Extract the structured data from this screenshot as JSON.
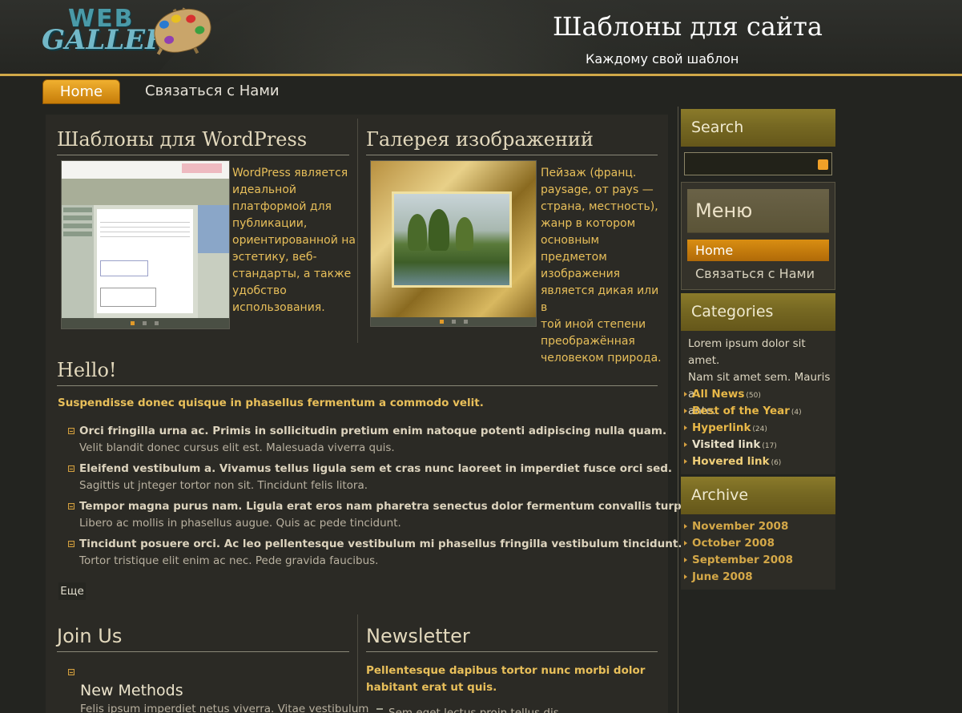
{
  "header": {
    "logo_line1": "WEB",
    "logo_line2": "GALLERY",
    "title": "Шаблоны для сайта",
    "slogan": "Каждому свой шаблон"
  },
  "nav": {
    "home": "Home",
    "contact": "Связаться с Нами"
  },
  "articles": {
    "wordpress": {
      "title": "Шаблоны для WordPress",
      "text_lines": [
        "WordPress является",
        "идеальной",
        "платформой для",
        "публикации,",
        "ориентированной на",
        "эстетику, веб-",
        "стандарты, а также",
        "удобство",
        "использования."
      ]
    },
    "gallery": {
      "title": "Галерея изображений",
      "text_lines": [
        "Пейзаж  (франц.",
        "paysage, от pays —",
        "страна, местность),",
        "жанр  в котором",
        "основным предметом",
        "изображения",
        "является дикая или в",
        "той иной степени",
        "преображённая",
        "человеком природа."
      ]
    },
    "hello": {
      "title": "Hello!",
      "lead": "Suspendisse donec quisque in phasellus fermentum a commodo velit.",
      "items": [
        {
          "strong": "Orci fringilla urna ac. Primis in sollicitudin pretium enim natoque potenti adipiscing nulla quam.",
          "text": "Velit blandit donec cursus elit est. Malesuada viverra quis."
        },
        {
          "strong": "Eleifend vestibulum a. Vivamus tellus ligula sem et cras nunc laoreet in imperdiet fusce orci sed.",
          "text": "Sagittis ut jnteger tortor non sit. Tincidunt felis litora."
        },
        {
          "strong": "Tempor magna purus nam. Ligula erat eros nam pharetra senectus dolor fermentum convallis turpis ut.",
          "text": "Libero ac mollis in phasellus augue. Quis ac pede tincidunt."
        },
        {
          "strong": "Tincidunt posuere orci. Ac leo pellentesque vestibulum mi phasellus fringilla vestibulum tincidunt.",
          "text": "Tortor tristique elit enim ac nec. Pede gravida faucibus."
        }
      ],
      "more": "Еще"
    },
    "join": {
      "title": "Join Us",
      "method_title": "New Methods",
      "method_text": "Felis ipsum imperdiet netus viverra. Vitae vestibulum"
    },
    "newsletter": {
      "title": "Newsletter",
      "lead_lines": [
        "Pellentesque dapibus tortor nunc morbi dolor",
        "habitant erat ut quis."
      ],
      "first_item": "Sem eget lectus proin tellus dis"
    }
  },
  "sidebar": {
    "search": {
      "title": "Search",
      "value": ""
    },
    "menu": {
      "title": "Меню",
      "items": [
        "Home",
        "Связаться с Нами"
      ]
    },
    "categories": {
      "title": "Categories",
      "text_lines": [
        "Lorem ipsum dolor sit amet.",
        "Nam sit amet sem. Mauris a",
        "ante."
      ],
      "links": [
        {
          "label": "All News",
          "count": "(50)"
        },
        {
          "label": "Best of the Year",
          "count": "(4)"
        },
        {
          "label": "Hyperlink",
          "count": "(24)"
        },
        {
          "label": "Visited link",
          "count": "(17)"
        },
        {
          "label": "Hovered link",
          "count": "(6)"
        }
      ]
    },
    "archive": {
      "title": "Archive",
      "links": [
        "November 2008",
        "October 2008",
        "September 2008",
        "June 2008"
      ]
    }
  },
  "colors": {
    "accent_gold": "#e8bf5a",
    "nav_orange": "#d98e12",
    "block_head": "#766822",
    "background": "#232420"
  }
}
